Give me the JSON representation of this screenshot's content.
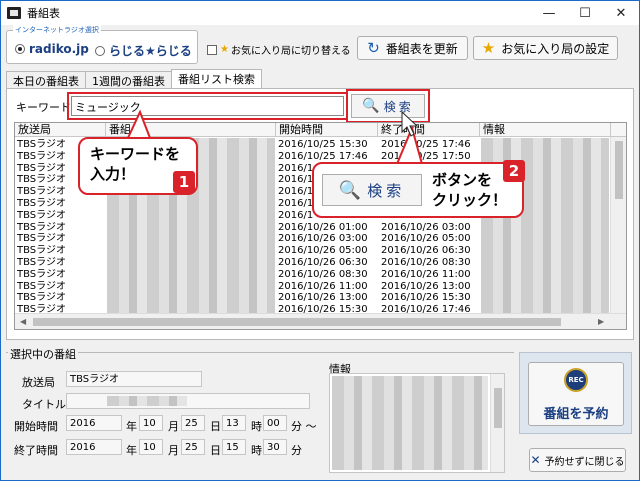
{
  "window": {
    "title": "番組表",
    "minimize": "—",
    "maximize": "☐",
    "close": "✕"
  },
  "source": {
    "group_label": "インターネットラジオ選択",
    "options": [
      {
        "label": "radiko.jp",
        "selected": true
      },
      {
        "label": "らじる★らじる",
        "selected": false
      }
    ]
  },
  "favorites_toggle": {
    "label": "お気に入り局に切り替える",
    "checked": false
  },
  "toolbar": {
    "refresh_label": "番組表を更新",
    "favorites_settings_label": "お気に入り局の設定"
  },
  "tabs": [
    {
      "label": "本日の番組表",
      "active": false
    },
    {
      "label": "1週間の番組表",
      "active": false
    },
    {
      "label": "番組リスト検索",
      "active": true
    }
  ],
  "search": {
    "keyword_label": "キーワード",
    "keyword_value": "ミュージック",
    "button_label": "検索"
  },
  "grid": {
    "columns": [
      "放送局",
      "番組",
      "開始時間",
      "終了時間",
      "情報"
    ],
    "rows": [
      {
        "station": "TBSラジオ",
        "start": "2016/10/25 15:30",
        "end": "2016/10/25 17:46"
      },
      {
        "station": "TBSラジオ",
        "start": "2016/10/25 17:46",
        "end": "2016/10/25 17:50"
      },
      {
        "station": "TBSラジオ",
        "start": "2016/1",
        "end": ""
      },
      {
        "station": "TBSラジオ",
        "start": "2016/1",
        "end": ""
      },
      {
        "station": "TBSラジオ",
        "start": "2016/1",
        "end": ""
      },
      {
        "station": "TBSラジオ",
        "start": "2016/1",
        "end": ""
      },
      {
        "station": "TBSラジオ",
        "start": "2016/1",
        "end": ""
      },
      {
        "station": "TBSラジオ",
        "start": "2016/10/26 01:00",
        "end": "2016/10/26 03:00"
      },
      {
        "station": "TBSラジオ",
        "start": "2016/10/26 03:00",
        "end": "2016/10/26 05:00"
      },
      {
        "station": "TBSラジオ",
        "start": "2016/10/26 05:00",
        "end": "2016/10/26 06:30"
      },
      {
        "station": "TBSラジオ",
        "start": "2016/10/26 06:30",
        "end": "2016/10/26 08:30"
      },
      {
        "station": "TBSラジオ",
        "start": "2016/10/26 08:30",
        "end": "2016/10/26 11:00"
      },
      {
        "station": "TBSラジオ",
        "start": "2016/10/26 11:00",
        "end": "2016/10/26 13:00"
      },
      {
        "station": "TBSラジオ",
        "start": "2016/10/26 13:00",
        "end": "2016/10/26 15:30"
      },
      {
        "station": "TBSラジオ",
        "start": "2016/10/26 15:30",
        "end": "2016/10/26 17:46"
      }
    ]
  },
  "callouts": {
    "keyword": {
      "line1": "キーワードを",
      "line2": "入力！",
      "badge": "1"
    },
    "search": {
      "line1": "ボタンを",
      "line2": "クリック！",
      "badge": "2",
      "zoom_label": "検索"
    }
  },
  "selected": {
    "group_label": "選択中の番組",
    "station_label": "放送局",
    "station_value": "TBSラジオ",
    "title_label": "タイトル",
    "start_label": "開始時間",
    "end_label": "終了時間",
    "start": {
      "year": "2016",
      "month": "10",
      "day": "25",
      "hour": "13",
      "minute": "00"
    },
    "end": {
      "year": "2016",
      "month": "10",
      "day": "25",
      "hour": "15",
      "minute": "30"
    },
    "units": {
      "year": "年",
      "month": "月",
      "day": "日",
      "hour": "時",
      "minute": "分",
      "tilde": "分 ～"
    },
    "info_label": "情報"
  },
  "actions": {
    "rec_icon_text": "REC",
    "reserve_label": "番組を予約",
    "close_label": "予約せずに閉じる"
  },
  "colors": {
    "accent": "#1b3f82",
    "highlight": "#d9222a",
    "star": "#e8a800"
  }
}
